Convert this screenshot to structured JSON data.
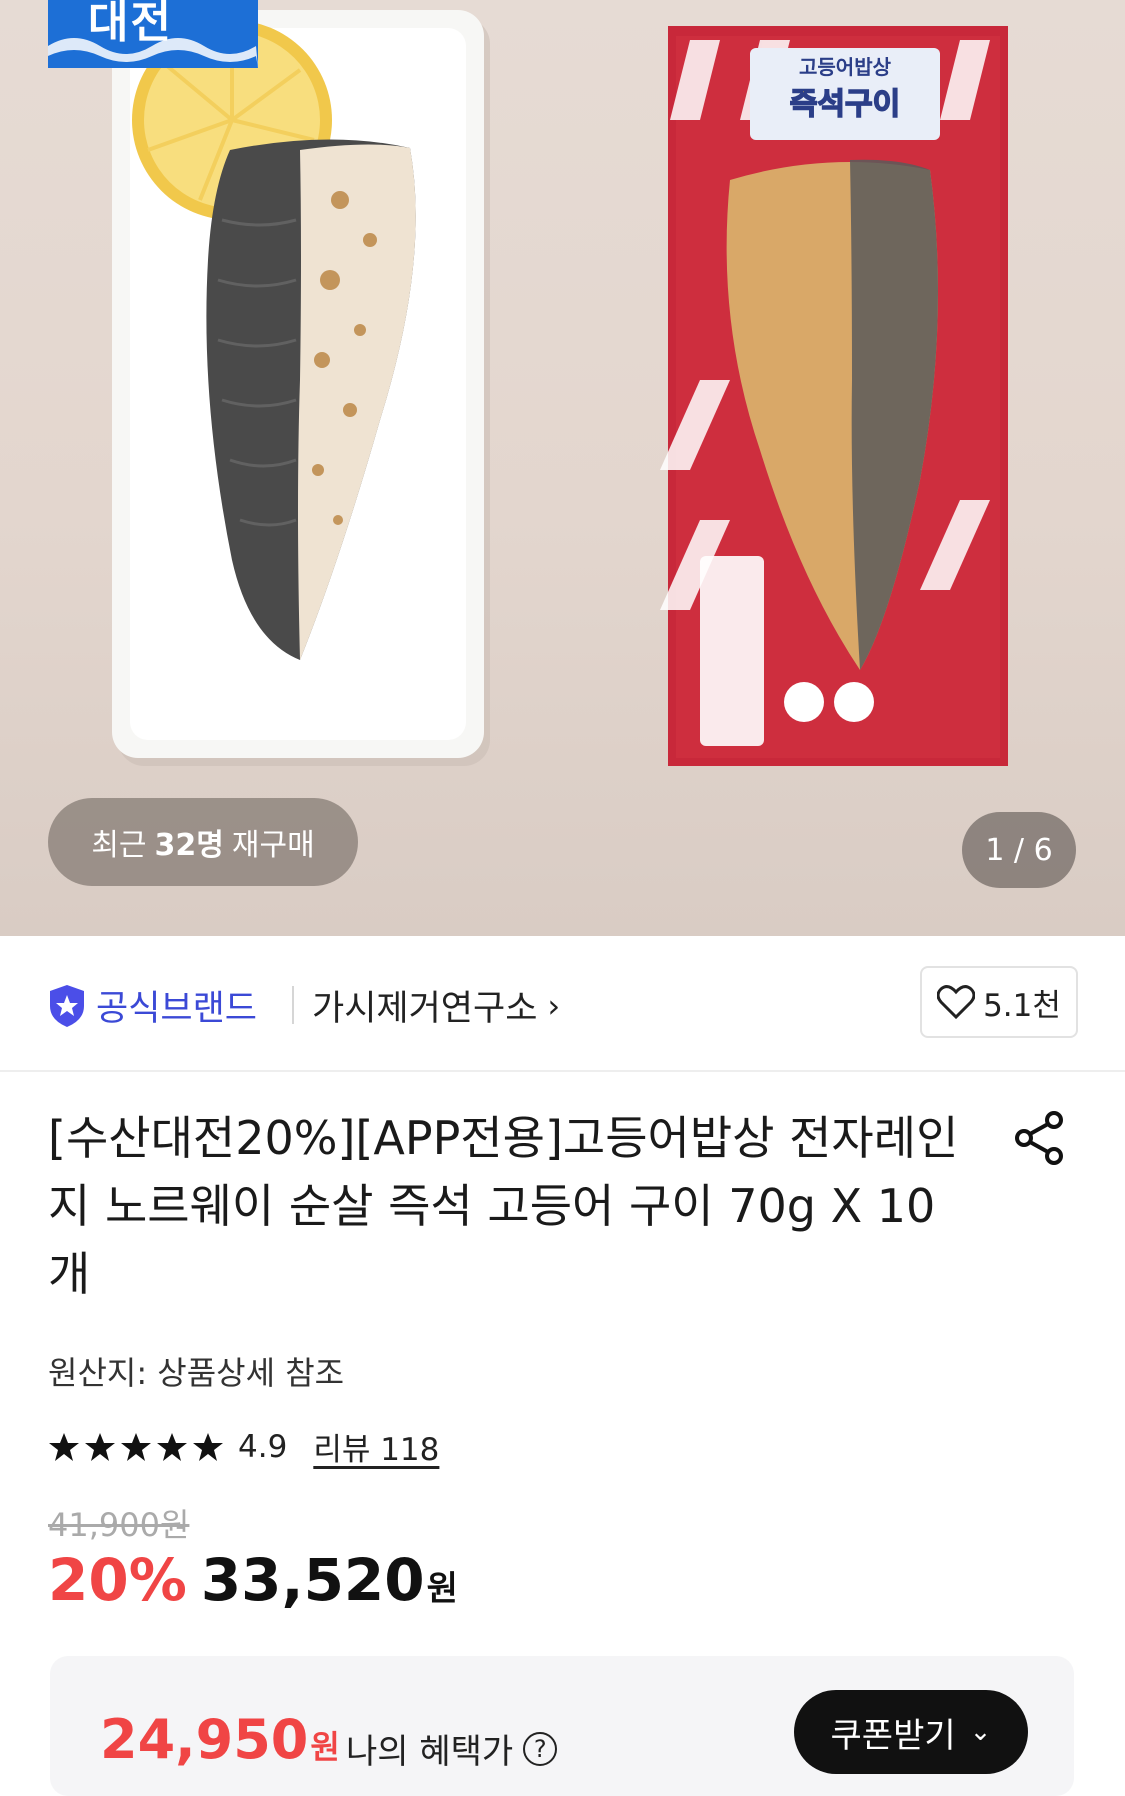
{
  "hero": {
    "logo_text": "대전",
    "product_pack_label_top": "고등어밥상",
    "product_pack_label_main": "즉석구이",
    "repurchase_prefix": "최근",
    "repurchase_count": "32명",
    "repurchase_suffix": "재구매",
    "image_counter": "1 / 6"
  },
  "brand": {
    "official_label": "공식브랜드",
    "store_name": "가시제거연구소",
    "likes": "5.1천"
  },
  "product": {
    "title": "[수산대전20%][APP전용]고등어밥상 전자레인지 노르웨이 순살 즉석 고등어 구이 70g X 10개",
    "origin": "원산지: 상품상세 참조",
    "rating": "4.9",
    "stars": 5,
    "review_link": "리뷰 118",
    "original_price": "41,900원",
    "discount": "20%",
    "price": "33,520",
    "currency": "원"
  },
  "benefit": {
    "price": "24,950",
    "currency": "원",
    "label": "나의 혜택가",
    "help": "?",
    "coupon_button": "쿠폰받기"
  },
  "colors": {
    "accent_red": "#f04545",
    "brand_blue": "#3b49d6",
    "package_red": "#c8283a"
  }
}
